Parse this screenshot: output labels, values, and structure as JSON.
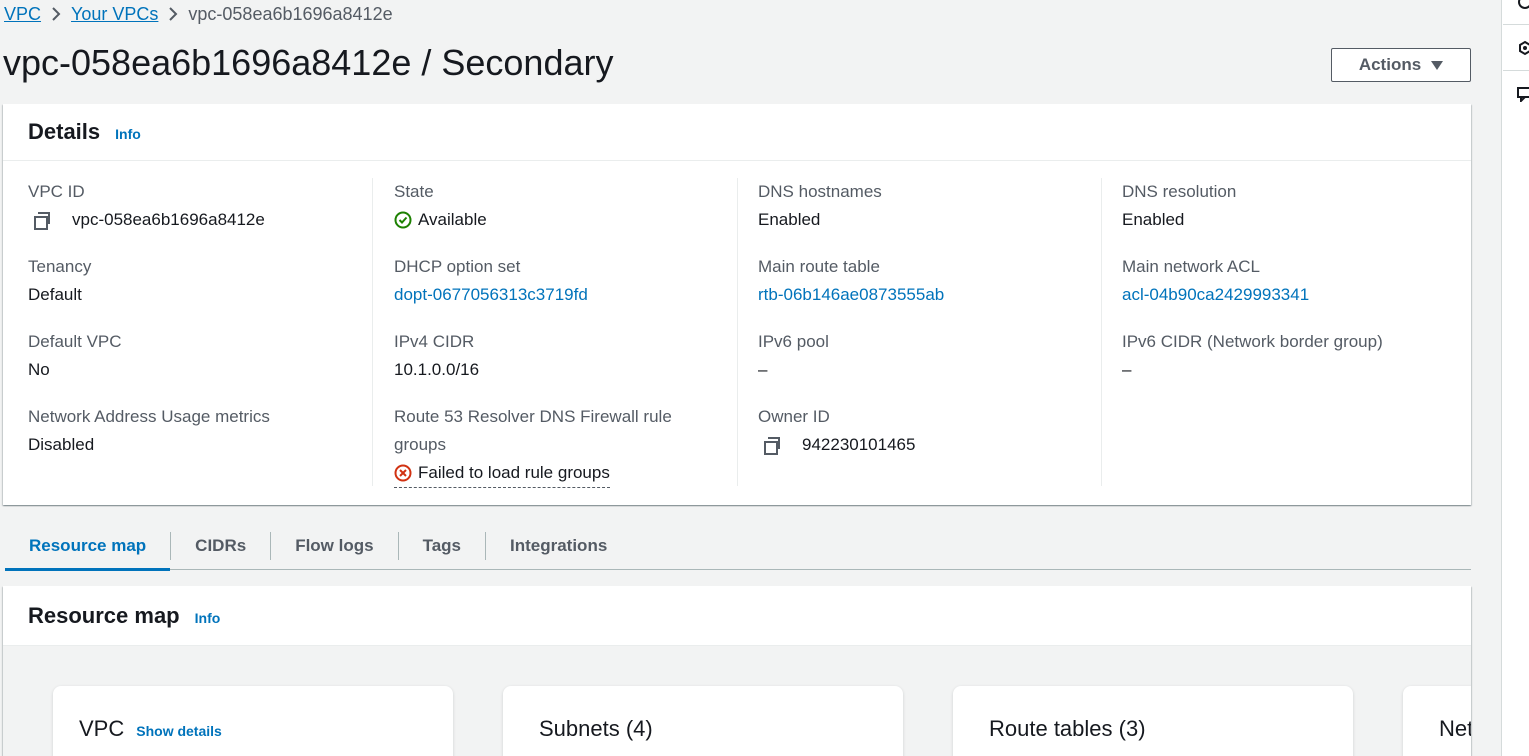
{
  "breadcrumb": {
    "items": [
      "VPC",
      "Your VPCs"
    ],
    "current": "vpc-058ea6b1696a8412e"
  },
  "page": {
    "title": "vpc-058ea6b1696a8412e / Secondary",
    "actions_label": "Actions"
  },
  "details": {
    "title": "Details",
    "info": "Info",
    "col1": {
      "vpc_id_label": "VPC ID",
      "vpc_id_value": "vpc-058ea6b1696a8412e",
      "tenancy_label": "Tenancy",
      "tenancy_value": "Default",
      "default_vpc_label": "Default VPC",
      "default_vpc_value": "No",
      "nau_label": "Network Address Usage metrics",
      "nau_value": "Disabled"
    },
    "col2": {
      "state_label": "State",
      "state_value": "Available",
      "dhcp_label": "DHCP option set",
      "dhcp_value": "dopt-0677056313c3719fd",
      "ipv4_label": "IPv4 CIDR",
      "ipv4_value": "10.1.0.0/16",
      "r53_label_line1": "Route 53 Resolver DNS Firewall rule",
      "r53_label_line2": "groups",
      "r53_value": "Failed to load rule groups"
    },
    "col3": {
      "dns_hostnames_label": "DNS hostnames",
      "dns_hostnames_value": "Enabled",
      "main_rt_label": "Main route table",
      "main_rt_value": "rtb-06b146ae0873555ab",
      "ipv6_pool_label": "IPv6 pool",
      "ipv6_pool_value": "–",
      "owner_label": "Owner ID",
      "owner_value": "942230101465"
    },
    "col4": {
      "dns_resolution_label": "DNS resolution",
      "dns_resolution_value": "Enabled",
      "main_acl_label": "Main network ACL",
      "main_acl_value": "acl-04b90ca2429993341",
      "ipv6_cidr_label": "IPv6 CIDR (Network border group)",
      "ipv6_cidr_value": "–"
    }
  },
  "tabs": [
    {
      "label": "Resource map",
      "active": true
    },
    {
      "label": "CIDRs",
      "active": false
    },
    {
      "label": "Flow logs",
      "active": false
    },
    {
      "label": "Tags",
      "active": false
    },
    {
      "label": "Integrations",
      "active": false
    }
  ],
  "resource_map": {
    "title": "Resource map",
    "info": "Info",
    "cards": {
      "vpc": "VPC",
      "vpc_show": "Show details",
      "subnets": "Subnets (4)",
      "route_tables": "Route tables (3)",
      "network_partial": "Net"
    }
  },
  "colors": {
    "link": "#0073bb",
    "success": "#1d8102",
    "error": "#d13212",
    "background": "#f2f3f3"
  }
}
